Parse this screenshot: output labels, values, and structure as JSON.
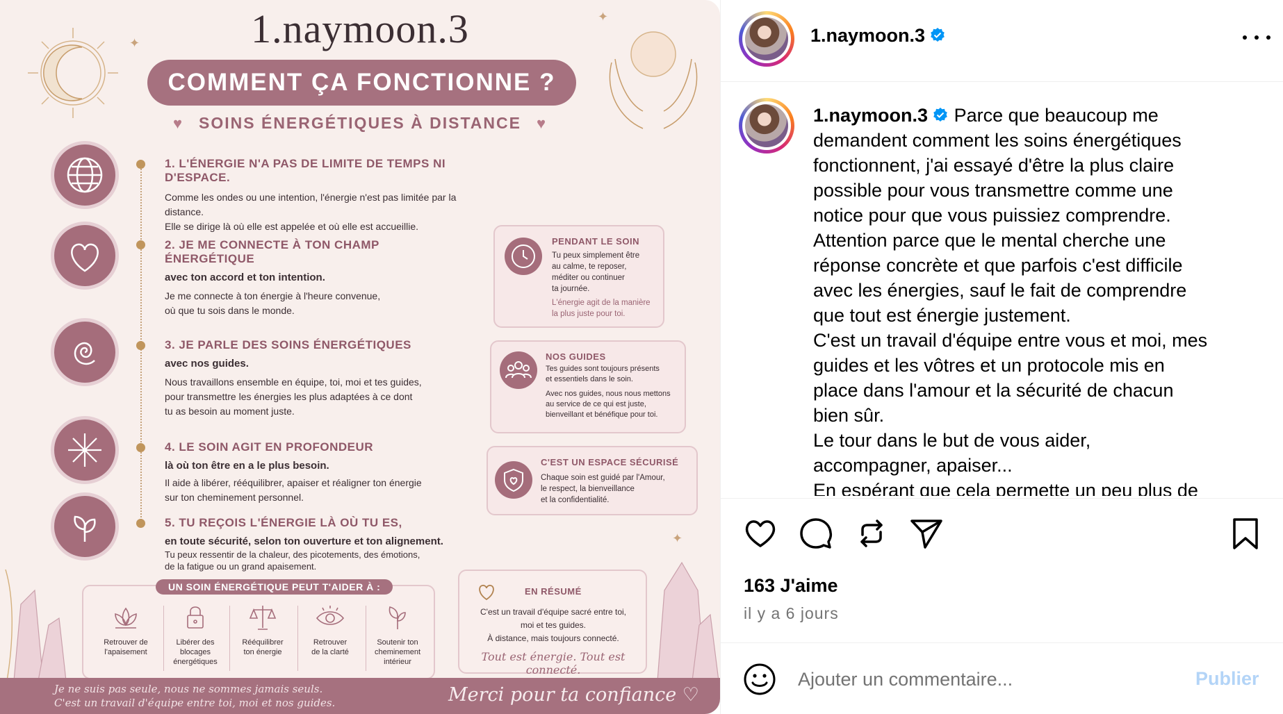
{
  "infographic": {
    "handle": "1.naymoon.3",
    "title": "COMMENT ÇA FONCTIONNE ?",
    "subtitle": "SOINS ÉNERGÉTIQUES À DISTANCE",
    "steps": [
      {
        "title": "1. L'ÉNERGIE N'A PAS DE LIMITE DE TEMPS NI D'ESPACE.",
        "lead": "",
        "text": [
          "Comme les ondes ou une intention, l'énergie n'est pas limitée par la distance.",
          "Elle se dirige là où elle est appelée et où elle est accueillie."
        ]
      },
      {
        "title": "2. JE ME CONNECTE À TON CHAMP ÉNERGÉTIQUE",
        "lead": "avec ton accord et ton intention.",
        "text": [
          "Je me connecte à ton énergie à l'heure convenue,",
          "où que tu sois dans le monde."
        ]
      },
      {
        "title": "3. JE PARLE DES SOINS ÉNERGÉTIQUES",
        "lead": "avec nos guides.",
        "text": [
          "Nous travaillons ensemble en équipe, toi, moi et tes guides,",
          "pour transmettre les énergies les plus adaptées à ce dont",
          "tu as besoin au moment juste."
        ]
      },
      {
        "title": "4. LE SOIN AGIT EN PROFONDEUR",
        "lead": "là où ton être en a le plus besoin.",
        "text": [
          "Il aide à libérer, rééquilibrer, apaiser et réaligner ton énergie",
          "sur ton cheminement personnel."
        ]
      },
      {
        "title": "5. TU REÇOIS L'ÉNERGIE LÀ OÙ TU ES,",
        "lead": "en toute sécurité, selon ton ouverture et ton alignement.",
        "text": [
          "Tu peux ressentir de la chaleur, des picotements, des émotions,",
          "de la fatigue ou un grand apaisement."
        ]
      }
    ],
    "boxes": [
      {
        "title": "PENDANT LE SOIN",
        "text": [
          "Tu peux simplement être",
          "au calme, te reposer,",
          "méditer ou continuer",
          "ta journée."
        ],
        "note": [
          "L'énergie agit de la manière",
          "la plus juste pour toi."
        ]
      },
      {
        "title": "NOS GUIDES",
        "text": [
          "Tes guides sont toujours présents",
          "et essentiels dans le soin."
        ],
        "note": [
          "Avec nos guides, nous nous mettons",
          "au service de ce qui est juste,",
          "bienveillant et bénéfique pour toi."
        ]
      },
      {
        "title": "C'EST UN ESPACE SÉCURISÉ",
        "text": [
          "Chaque soin est guidé par l'Amour,",
          "le respect, la bienveillance",
          "et la confidentialité."
        ],
        "note": []
      }
    ],
    "help": {
      "label": "UN SOIN ÉNERGÉTIQUE PEUT T'AIDER À :",
      "items": [
        {
          "icon": "lotus-icon",
          "text": [
            "Retrouver de",
            "l'apaisement"
          ]
        },
        {
          "icon": "lock-icon",
          "text": [
            "Libérer des",
            "blocages",
            "énergétiques"
          ]
        },
        {
          "icon": "scales-icon",
          "text": [
            "Rééquilibrer",
            "ton énergie"
          ]
        },
        {
          "icon": "eye-icon",
          "text": [
            "Retrouver",
            "de la clarté"
          ]
        },
        {
          "icon": "sprout-icon",
          "text": [
            "Soutenir ton",
            "cheminement",
            "intérieur"
          ]
        }
      ]
    },
    "summary": {
      "title": "EN RÉSUMÉ",
      "text": [
        "C'est un travail d'équipe sacré entre toi,",
        "moi et tes guides.",
        "À distance, mais toujours connecté."
      ],
      "script": "Tout est énergie. Tout est connecté."
    },
    "footer": {
      "left": [
        "Je ne suis pas seule, nous ne sommes jamais seuls.",
        "C'est un travail d'équipe entre toi, moi et nos guides."
      ],
      "right": "Merci pour ta confiance"
    }
  },
  "post": {
    "username": "1.naymoon.3",
    "verified": true,
    "caption_lines": [
      "Parce que beaucoup me",
      "demandent comment les soins énergétiques",
      "fonctionnent, j'ai essayé d'être la plus claire",
      "possible pour vous transmettre comme une",
      "notice pour que vous puissiez comprendre.",
      "Attention parce que le mental cherche une",
      "réponse concrète et que parfois c'est difficile",
      "avec les énergies, sauf le fait de comprendre",
      "que tout est énergie justement.",
      "C'est un travail d'équipe entre vous et moi, mes",
      "guides et les vôtres et un protocole mis en",
      "place dans l'amour et la sécurité de chacun",
      "bien sûr.",
      "Le tour dans le but de vous aider,",
      "accompagner, apaiser...",
      "En espérant que cela permette un peu plus de"
    ],
    "likes": "163 J'aime",
    "time": "il y a 6 jours",
    "comment_placeholder": "Ajouter un commentaire...",
    "publish_label": "Publier"
  },
  "colors": {
    "brand_mauve": "#a6717f",
    "verified_blue": "#0095f6",
    "publish_disabled": "#b3d4f7"
  }
}
